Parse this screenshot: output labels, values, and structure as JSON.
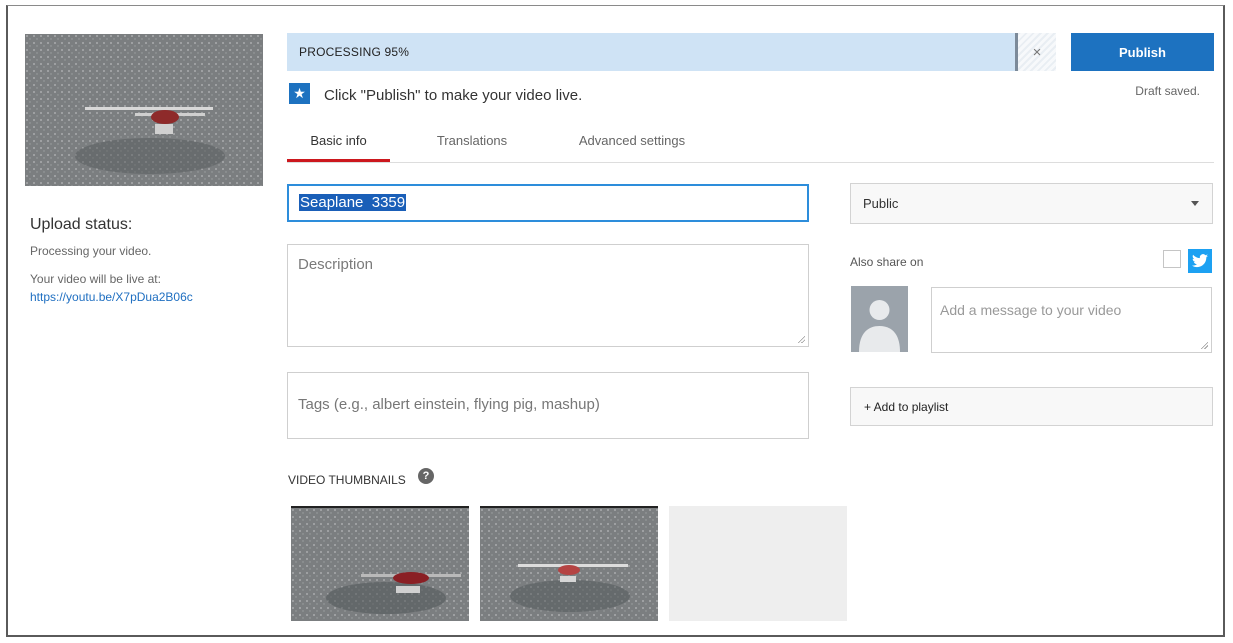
{
  "upload": {
    "status_title": "Upload status:",
    "processing_text": "Processing your video.",
    "live_at_text": "Your video will be live at:",
    "video_link": "https://youtu.be/X7pDua2B06c"
  },
  "progress": {
    "label": "PROCESSING 95%",
    "percent": 95,
    "cancel_icon": "close-icon"
  },
  "publish": {
    "button_label": "Publish",
    "hint_text": "Click \"Publish\" to make your video live.",
    "draft_status": "Draft saved."
  },
  "tabs": [
    {
      "label": "Basic info",
      "active": true
    },
    {
      "label": "Translations",
      "active": false
    },
    {
      "label": "Advanced settings",
      "active": false
    }
  ],
  "form": {
    "title_value": "Seaplane  3359",
    "description_placeholder": "Description",
    "tags_placeholder": "Tags (e.g., albert einstein, flying pig, mashup)"
  },
  "sidebar": {
    "visibility_value": "Public",
    "also_share_label": "Also share on",
    "share_message_placeholder": "Add a message to your video",
    "add_to_playlist_label": "+ Add to playlist"
  },
  "thumbnails": {
    "label": "VIDEO THUMBNAILS",
    "help_icon": "?"
  },
  "colors": {
    "accent_blue": "#1d72c0",
    "progress_bg": "#cfe3f5",
    "active_tab_red": "#cc181e",
    "twitter_blue": "#1da1f2"
  }
}
